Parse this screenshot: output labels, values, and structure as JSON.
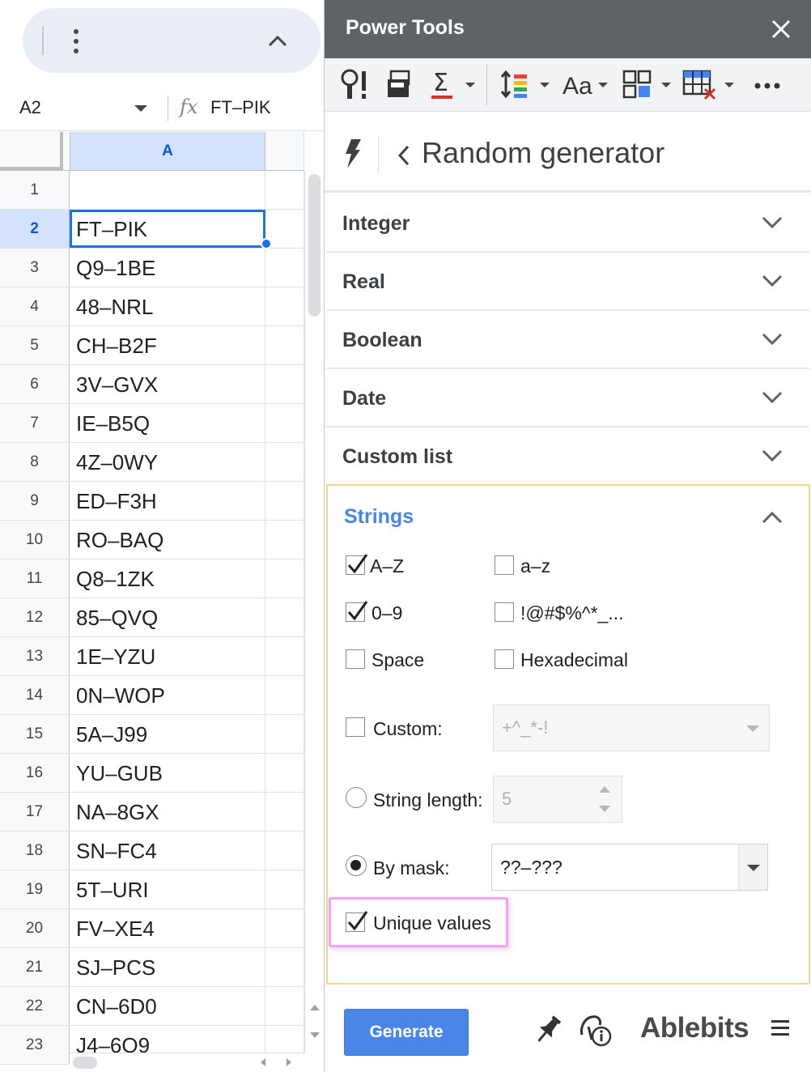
{
  "sheet": {
    "name_box": "A2",
    "formula_value": "FT–PIK",
    "fx_label": "fx",
    "column_header": "A",
    "rows": [
      {
        "num": "1",
        "value": ""
      },
      {
        "num": "2",
        "value": "FT–PIK"
      },
      {
        "num": "3",
        "value": "Q9–1BE"
      },
      {
        "num": "4",
        "value": "48–NRL"
      },
      {
        "num": "5",
        "value": "CH–B2F"
      },
      {
        "num": "6",
        "value": "3V–GVX"
      },
      {
        "num": "7",
        "value": "IE–B5Q"
      },
      {
        "num": "8",
        "value": "4Z–0WY"
      },
      {
        "num": "9",
        "value": "ED–F3H"
      },
      {
        "num": "10",
        "value": "RO–BAQ"
      },
      {
        "num": "11",
        "value": "Q8–1ZK"
      },
      {
        "num": "12",
        "value": "85–QVQ"
      },
      {
        "num": "13",
        "value": "1E–YZU"
      },
      {
        "num": "14",
        "value": "0N–WOP"
      },
      {
        "num": "15",
        "value": "5A–J99"
      },
      {
        "num": "16",
        "value": "YU–GUB"
      },
      {
        "num": "17",
        "value": "NA–8GX"
      },
      {
        "num": "18",
        "value": "SN–FC4"
      },
      {
        "num": "19",
        "value": "5T–URI"
      },
      {
        "num": "20",
        "value": "FV–XE4"
      },
      {
        "num": "21",
        "value": "SJ–PCS"
      },
      {
        "num": "22",
        "value": "CN–6D0"
      },
      {
        "num": "23",
        "value": "J4–6O9"
      }
    ]
  },
  "sidebar": {
    "title": "Power Tools",
    "page_title": "Random generator",
    "accordions": [
      "Integer",
      "Real",
      "Boolean",
      "Date",
      "Custom list"
    ],
    "strings": {
      "label": "Strings",
      "opt_az_upper": "A–Z",
      "opt_az_lower": "a–z",
      "opt_digits": "0–9",
      "opt_special": "!@#$%^*_...",
      "opt_space": "Space",
      "opt_hex": "Hexadecimal",
      "custom_label": "Custom:",
      "custom_value": "+^_*-!",
      "length_label": "String length:",
      "length_value": "5",
      "mask_label": "By mask:",
      "mask_value": "??–???",
      "unique_label": "Unique values"
    },
    "generate_label": "Generate",
    "brand": "Ablebits"
  },
  "colors": {
    "header_bg": "#5f6368",
    "accent_blue": "#4a86e8",
    "selection_blue": "#1a73e8",
    "strings_border": "#f3d58b",
    "highlight_pink": "#f3a2f2"
  },
  "icons": [
    "more-vert-icon",
    "chevron-up-icon",
    "close-icon",
    "bolt-icon",
    "back-chevron-icon",
    "pin-icon",
    "info-icon",
    "menu-icon"
  ]
}
